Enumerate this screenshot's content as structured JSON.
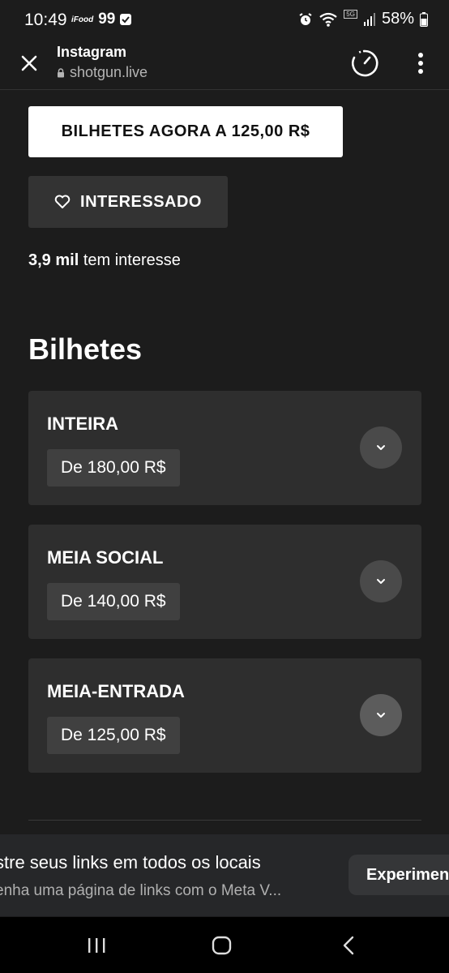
{
  "status_bar": {
    "time": "10:49",
    "app_badge_text": "iFood",
    "nine_nine": "99",
    "network_badge": "5G",
    "battery": "58%"
  },
  "browser": {
    "title": "Instagram",
    "url": "shotgun.live"
  },
  "event": {
    "buy_button": "BILHETES AGORA A 125,00 R$",
    "interest_button": "INTERESSADO",
    "interest_count_bold": "3,9 mil",
    "interest_count_text": " tem interesse"
  },
  "tickets": {
    "section_title": "Bilhetes",
    "items": [
      {
        "name": "INTEIRA",
        "price": "De 180,00 R$"
      },
      {
        "name": "MEIA SOCIAL",
        "price": "De 140,00 R$"
      },
      {
        "name": "MEIA-ENTRADA",
        "price": "De 125,00 R$"
      }
    ]
  },
  "ad": {
    "title": "stre seus links em todos os locais",
    "subtitle": "enha uma página de links com o Meta V...",
    "button": "Experimen"
  },
  "icons": {
    "close": "close-icon",
    "lock": "lock-icon",
    "timer": "timer-icon",
    "more": "more-vertical-icon",
    "heart": "heart-icon",
    "chevron": "chevron-down-icon",
    "alarm": "alarm-icon",
    "wifi": "wifi-icon",
    "signal": "signal-icon",
    "battery": "battery-icon"
  }
}
